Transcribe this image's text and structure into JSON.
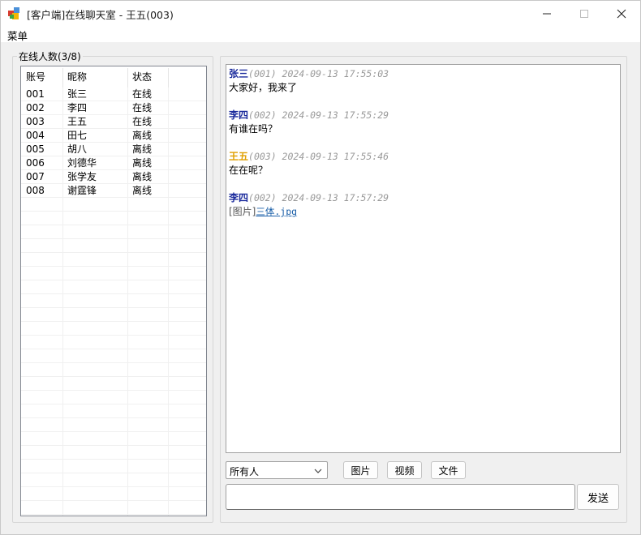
{
  "window": {
    "title": "[客户端]在线聊天室 - 王五(003)"
  },
  "menu": {
    "items": [
      {
        "label": "菜单"
      }
    ]
  },
  "user_panel": {
    "group_label": "在线人数(3/8)",
    "columns": [
      "账号",
      "昵称",
      "状态"
    ],
    "rows": [
      [
        "001",
        "张三",
        "在线"
      ],
      [
        "002",
        "李四",
        "在线"
      ],
      [
        "003",
        "王五",
        "在线"
      ],
      [
        "004",
        "田七",
        "离线"
      ],
      [
        "005",
        "胡八",
        "离线"
      ],
      [
        "006",
        "刘德华",
        "离线"
      ],
      [
        "007",
        "张学友",
        "离线"
      ],
      [
        "008",
        "谢霆锋",
        "离线"
      ]
    ]
  },
  "chat": {
    "messages": [
      {
        "name": "张三",
        "meta": "(001) 2024-09-13 17:55:03",
        "text": "大家好，我来了",
        "name_color": "#1a2a9c"
      },
      {
        "name": "李四",
        "meta": "(002) 2024-09-13 17:55:29",
        "text": "有谁在吗？",
        "name_color": "#1a2a9c"
      },
      {
        "name": "王五",
        "meta": "(003) 2024-09-13 17:55:46",
        "text": "在在呢？",
        "name_color": "#e0a000"
      },
      {
        "name": "李四",
        "meta": "(002) 2024-09-13 17:57:29",
        "image_label": "[图片]",
        "image_link": "三体.jpg",
        "name_color": "#1a2a9c"
      }
    ]
  },
  "controls": {
    "recipient": "所有人",
    "image_button": "图片",
    "video_button": "视频",
    "file_button": "文件",
    "send_button": "发送",
    "message_input_value": ""
  },
  "colors": {
    "self_name": "#e0a000",
    "other_name": "#1a2a9c",
    "link": "#1a5fa8",
    "meta": "#999999"
  }
}
